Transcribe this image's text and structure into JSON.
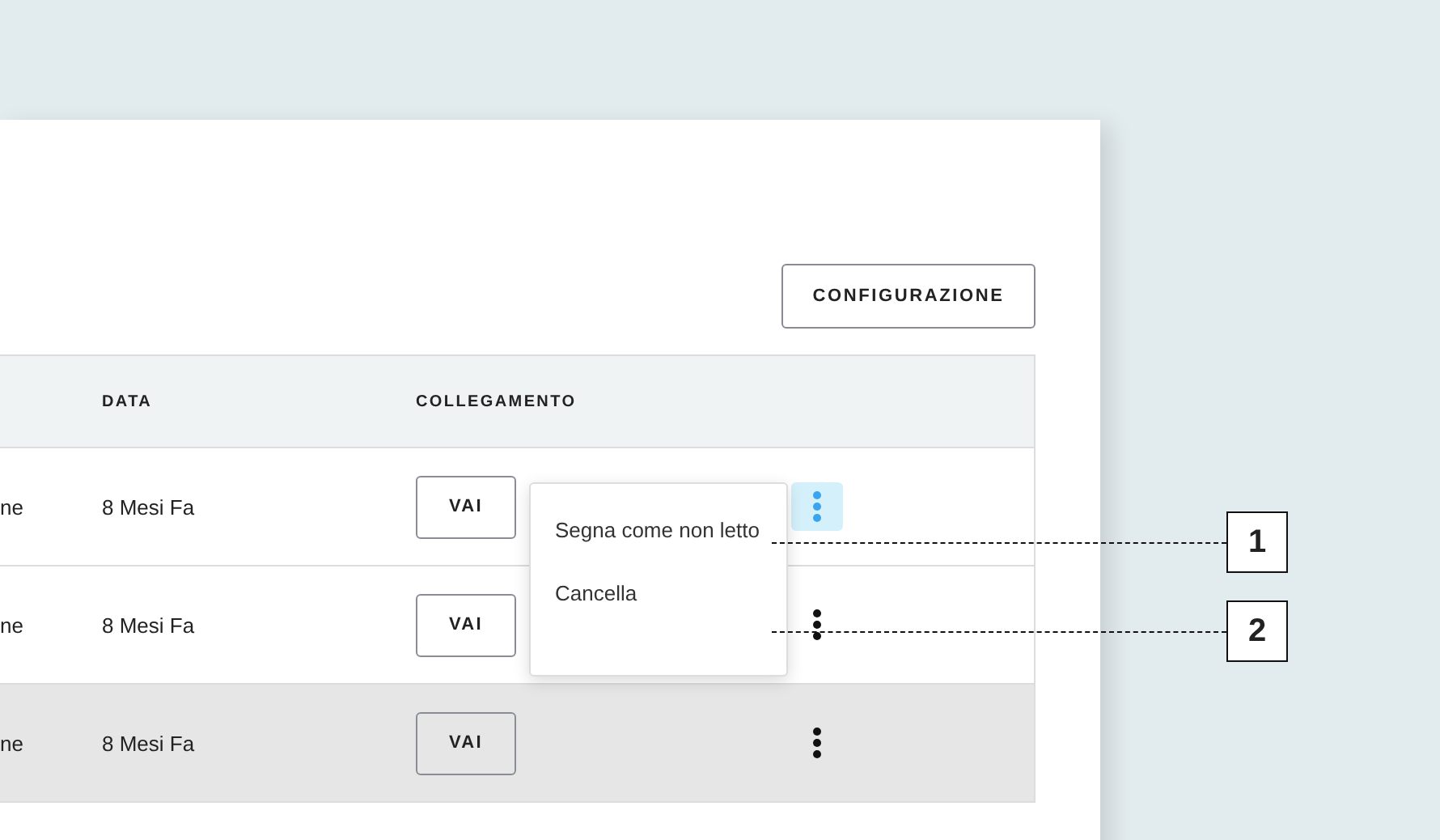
{
  "toolbar": {
    "button": "CONFIGURAZIONE"
  },
  "table": {
    "columns": [
      "DATA",
      "COLLEGAMENTO"
    ],
    "rows": [
      {
        "column_1": "ne",
        "date": "8 Mesi Fa",
        "link": "VAI",
        "menu_open": true,
        "highlighted": false
      },
      {
        "column_1": "ne",
        "date": "8 Mesi Fa",
        "link": "VAI",
        "menu_open": false,
        "highlighted": false
      },
      {
        "column_1": "ne",
        "date": "8 Mesi Fa",
        "link": "VAI",
        "menu_open": false,
        "highlighted": true
      }
    ]
  },
  "menu": {
    "items": [
      "Segna come non letto",
      "Cancella"
    ]
  },
  "callouts": [
    "1",
    "2"
  ]
}
